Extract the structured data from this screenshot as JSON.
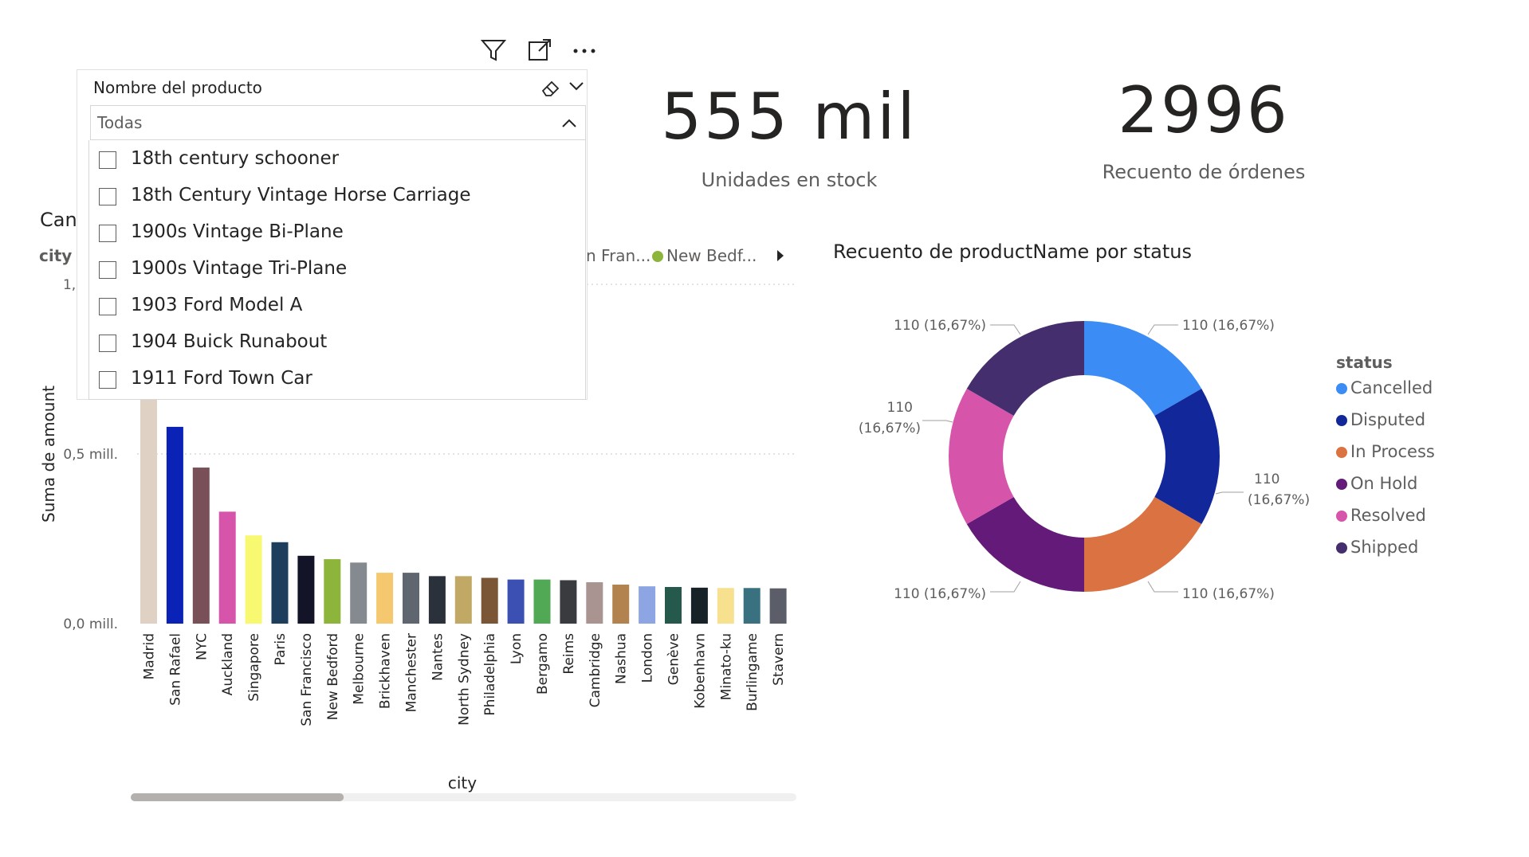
{
  "visual_header": {
    "filter_icon": "filter-icon",
    "focus_icon": "focus-mode-icon",
    "more_icon": "more-options-icon"
  },
  "slicer": {
    "title": "Nombre del producto",
    "dropdown_value": "Todas",
    "items": [
      "18th century schooner",
      "18th Century Vintage Horse Carriage",
      "1900s Vintage Bi-Plane",
      "1900s Vintage Tri-Plane",
      "1903 Ford Model A",
      "1904 Buick Runabout",
      "1911 Ford Town Car"
    ]
  },
  "cards": [
    {
      "value": "555 mil",
      "label": "Unidades en stock"
    },
    {
      "value": "2996",
      "label": "Recuento de órdenes"
    }
  ],
  "bar_visual": {
    "title_partial": "Canti",
    "legend_label": "city",
    "legend_entries_visible": [
      "n Fran...",
      "New Bedf..."
    ],
    "legend_colors": [
      "#dfd1c4",
      "#8db43b"
    ],
    "y_tick_top_partial": "1,0",
    "scroll_fraction": 0.32
  },
  "chart_data": [
    {
      "type": "bar",
      "xlabel": "city",
      "ylabel": "Suma de amount",
      "ylim": [
        0,
        1.0
      ],
      "yticks": [
        "0,0 mill.",
        "0,5 mill.",
        "1,0"
      ],
      "grid": true,
      "categories": [
        "Madrid",
        "San Rafael",
        "NYC",
        "Auckland",
        "Singapore",
        "Paris",
        "San Francisco",
        "New Bedford",
        "Melbourne",
        "Brickhaven",
        "Manchester",
        "Nantes",
        "North Sydney",
        "Philadelphia",
        "Lyon",
        "Bergamo",
        "Reims",
        "Cambridge",
        "Nashua",
        "London",
        "Genève",
        "Kobenhavn",
        "Minato-ku",
        "Burlingame",
        "Stavern"
      ],
      "values": [
        1.0,
        0.58,
        0.46,
        0.33,
        0.26,
        0.24,
        0.2,
        0.19,
        0.18,
        0.15,
        0.15,
        0.14,
        0.14,
        0.135,
        0.13,
        0.13,
        0.128,
        0.122,
        0.115,
        0.11,
        0.108,
        0.106,
        0.105,
        0.105,
        0.104
      ],
      "colors": [
        "#dfd1c4",
        "#0b22b6",
        "#7a5058",
        "#d654aa",
        "#f8f871",
        "#1d3e5c",
        "#141428",
        "#8db43b",
        "#858990",
        "#f5c86f",
        "#5f6670",
        "#2b313a",
        "#c1a965",
        "#7a5536",
        "#3c4fb3",
        "#52a955",
        "#3a3b3f",
        "#a99492",
        "#b3834f",
        "#8da5e3",
        "#24594b",
        "#162128",
        "#f7e08e",
        "#3a7180",
        "#5b5e69"
      ]
    },
    {
      "type": "pie",
      "title": "Recuento de productName por status",
      "legend_title": "status",
      "legend_position": "right",
      "labels": [
        "Cancelled",
        "Disputed",
        "In Process",
        "On Hold",
        "Resolved",
        "Shipped"
      ],
      "values": [
        110,
        110,
        110,
        110,
        110,
        110
      ],
      "percent_labels": [
        "110 (16,67%)",
        "110 (16,67%)",
        "110 (16,67%)",
        "110 (16,67%)",
        "110 (16,67%)",
        "110 (16,67%)"
      ],
      "colors": [
        "#3b8cf5",
        "#12289a",
        "#db7242",
        "#641a78",
        "#d654aa",
        "#452e6e"
      ]
    }
  ]
}
